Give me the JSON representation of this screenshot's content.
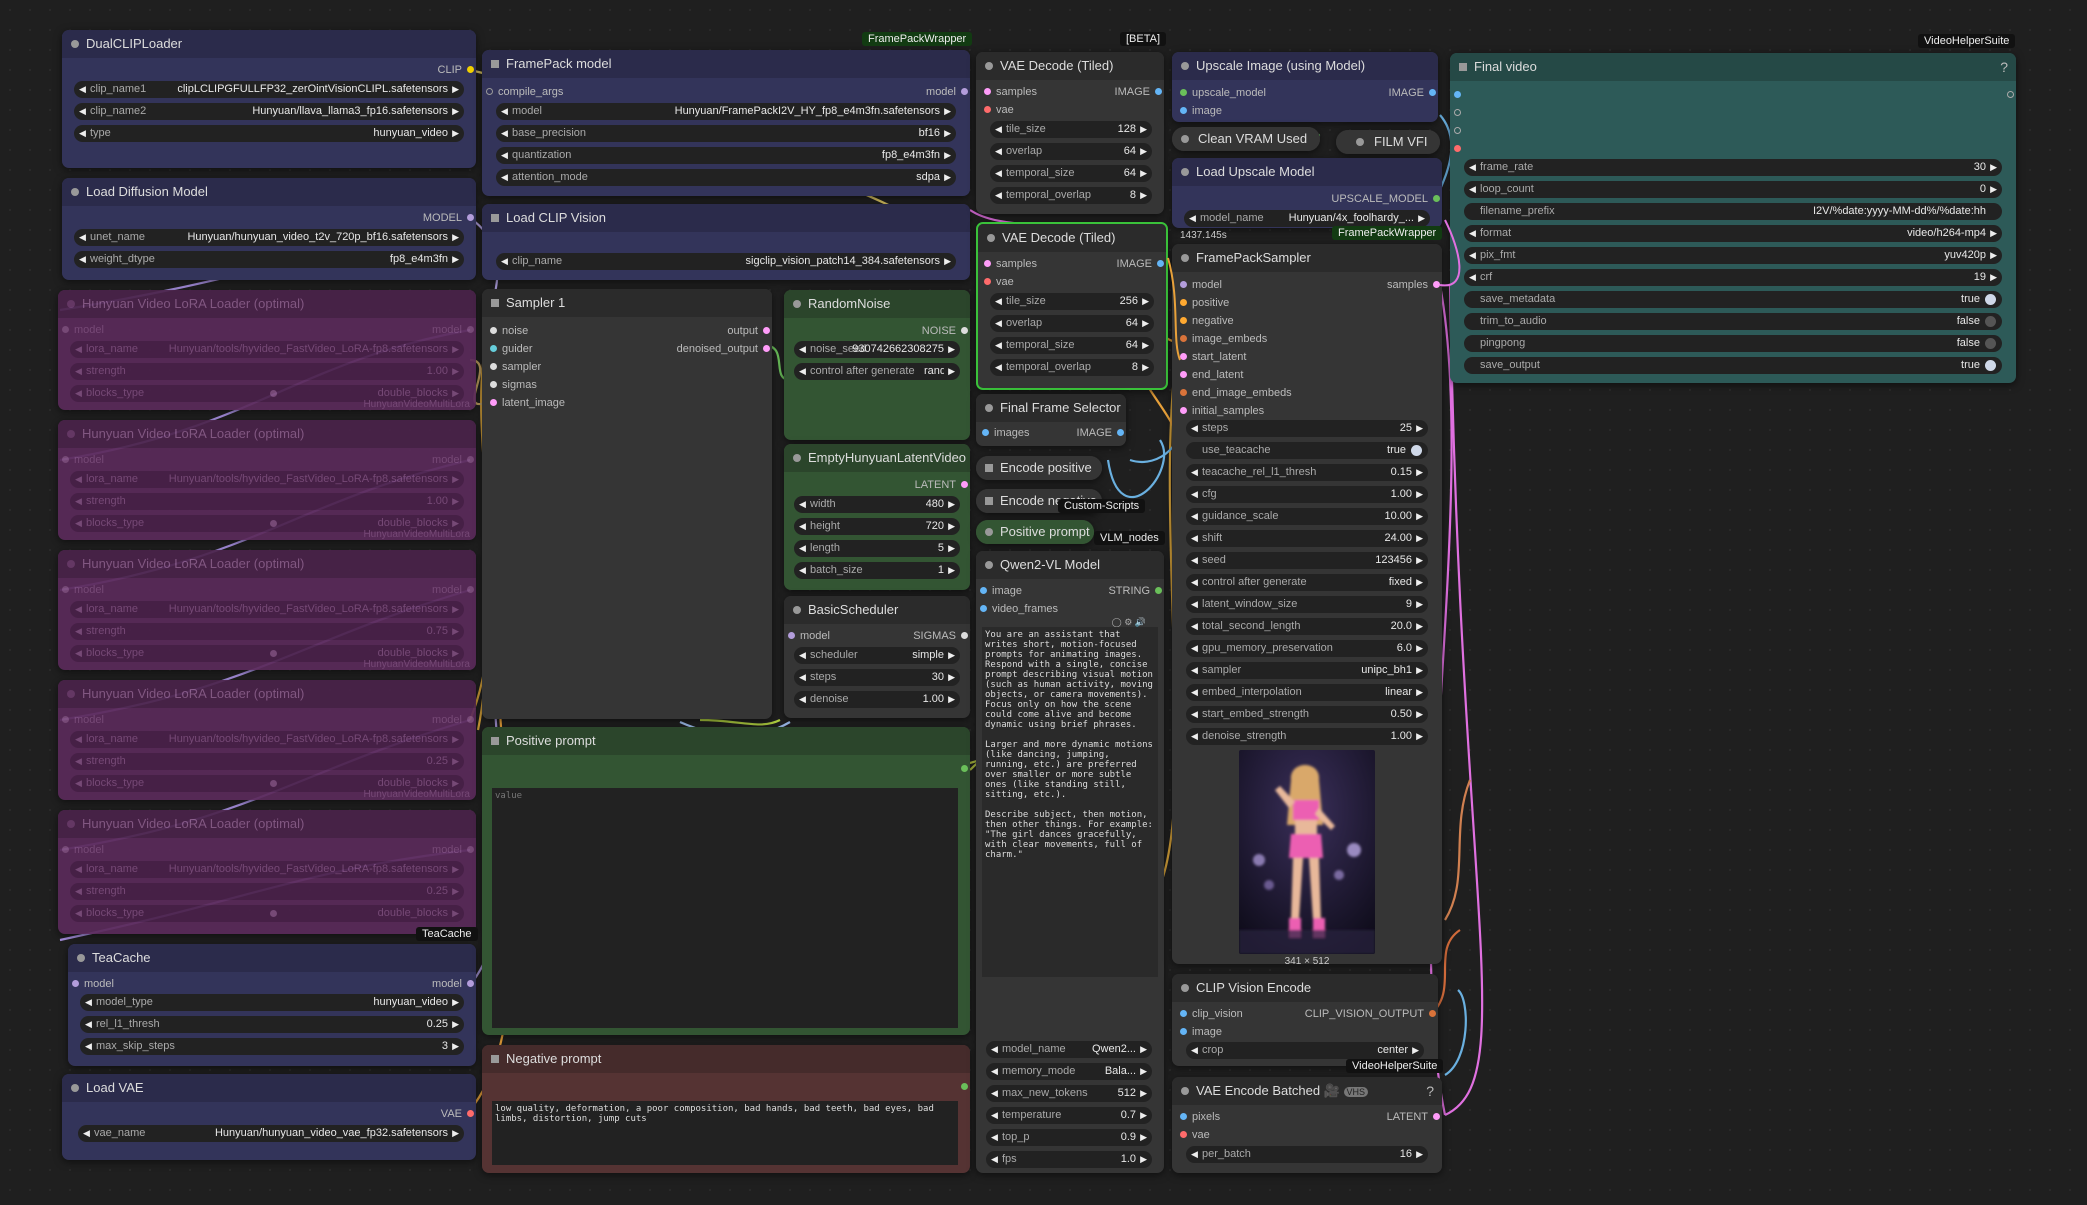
{
  "badges": {
    "framepackwrapper": "FramePackWrapper",
    "beta": "[BETA]",
    "videohelpersuite": "VideoHelperSuite",
    "framepackwrapper2": "FramePackWrapper",
    "customscripts": "Custom-Scripts",
    "vlmnodes": "VLM_nodes",
    "teacache_tag": "TeaCache",
    "videohelpersuite2": "VideoHelperSuite"
  },
  "dualclip": {
    "title": "DualCLIPLoader",
    "out": "CLIP",
    "clip_name1_l": "clip_name1",
    "clip_name1": "clipLCLIPGFULLFP32_zerOintVisionCLIPL.safetensors",
    "clip_name2_l": "clip_name2",
    "clip_name2": "Hunyuan/llava_llama3_fp16.safetensors",
    "type_l": "type",
    "type": "hunyuan_video"
  },
  "loaddiff": {
    "title": "Load Diffusion Model",
    "out": "MODEL",
    "unet_l": "unet_name",
    "unet": "Hunyuan/hunyuan_video_t2v_720p_bf16.safetensors",
    "dtype_l": "weight_dtype",
    "dtype": "fp8_e4m3fn"
  },
  "lora": [
    {
      "title": "Hunyuan Video LoRA Loader (optimal)",
      "lora": "Hunyuan/tools/hyvideo_FastVideo_LoRA-fp8.safetensors",
      "strength": "1.00",
      "blocks": "double_blocks",
      "foot": "HunyuanVideoMultiLora"
    },
    {
      "title": "Hunyuan Video LoRA Loader (optimal)",
      "lora": "Hunyuan/tools/hyvideo_FastVideo_LoRA-fp8.safetensors",
      "strength": "1.00",
      "blocks": "double_blocks",
      "foot": "HunyuanVideoMultiLora"
    },
    {
      "title": "Hunyuan Video LoRA Loader (optimal)",
      "lora": "Hunyuan/tools/hyvideo_FastVideo_LoRA-fp8.safetensors",
      "strength": "0.75",
      "blocks": "double_blocks",
      "foot": "HunyuanVideoMultiLora"
    },
    {
      "title": "Hunyuan Video LoRA Loader (optimal)",
      "lora": "Hunyuan/tools/hyvideo_FastVideo_LoRA-fp8.safetensors",
      "strength": "0.25",
      "blocks": "double_blocks",
      "foot": "HunyuanVideoMultiLora"
    },
    {
      "title": "Hunyuan Video LoRA Loader (optimal)",
      "lora": "Hunyuan/tools/hyvideo_FastVideo_LoRA-fp8.safetensors",
      "strength": "0.25",
      "blocks": "double_blocks",
      "foot": ""
    }
  ],
  "lora_labels": {
    "model": "model",
    "lora_name": "lora_name",
    "strength": "strength",
    "blocks_type": "blocks_type"
  },
  "teacache": {
    "title": "TeaCache",
    "in": "model",
    "out": "model",
    "model_type_l": "model_type",
    "model_type": "hunyuan_video",
    "rel_l": "rel_l1_thresh",
    "rel": "0.25",
    "max_l": "max_skip_steps",
    "max": "3"
  },
  "loadvae": {
    "title": "Load VAE",
    "out": "VAE",
    "vae_l": "vae_name",
    "vae": "Hunyuan/hunyuan_video_vae_fp32.safetensors"
  },
  "framepack": {
    "title": "FramePack model",
    "in": "compile_args",
    "out": "model",
    "model_l": "model",
    "model": "Hunyuan/FramePackI2V_HY_fp8_e4m3fn.safetensors",
    "prec_l": "base_precision",
    "prec": "bf16",
    "quant_l": "quantization",
    "quant": "fp8_e4m3fn",
    "attn_l": "attention_mode",
    "attn": "sdpa"
  },
  "loadclipvision": {
    "title": "Load CLIP Vision",
    "clip_l": "clip_name",
    "clip": "sigclip_vision_patch14_384.safetensors"
  },
  "sampler1": {
    "title": "Sampler 1",
    "in": [
      "noise",
      "guider",
      "sampler",
      "sigmas",
      "latent_image"
    ],
    "out1": "output",
    "out2": "denoised_output"
  },
  "randomnoise": {
    "title": "RandomNoise",
    "out": "NOISE",
    "seed_l": "noise_seed",
    "seed": "930742662308275",
    "ctl_l": "control after generate",
    "ctl": "randomize"
  },
  "emptylatent": {
    "title": "EmptyHunyuanLatentVideo",
    "out": "LATENT",
    "w_l": "width",
    "w": "480",
    "h_l": "height",
    "h": "720",
    "len_l": "length",
    "len": "5",
    "b_l": "batch_size",
    "b": "1"
  },
  "basicsched": {
    "title": "BasicScheduler",
    "in": "model",
    "out": "SIGMAS",
    "sch_l": "scheduler",
    "sch": "simple",
    "steps_l": "steps",
    "steps": "30",
    "den_l": "denoise",
    "den": "1.00"
  },
  "posprompt": {
    "title": "Positive prompt",
    "placeholder": "value"
  },
  "negprompt": {
    "title": "Negative prompt",
    "text": "low quality, deformation, a poor composition, bad hands, bad teeth, bad eyes, bad limbs, distortion, jump cuts"
  },
  "vaedec1": {
    "title": "VAE Decode (Tiled)",
    "in1": "samples",
    "in2": "vae",
    "out": "IMAGE",
    "tile_l": "tile_size",
    "tile": "128",
    "ov_l": "overlap",
    "ov": "64",
    "ts_l": "temporal_size",
    "ts": "64",
    "to_l": "temporal_overlap",
    "to": "8"
  },
  "vaedec2": {
    "title": "VAE Decode (Tiled)",
    "in1": "samples",
    "in2": "vae",
    "out": "IMAGE",
    "tile_l": "tile_size",
    "tile": "256",
    "ov_l": "overlap",
    "ov": "64",
    "ts_l": "temporal_size",
    "ts": "64",
    "to_l": "temporal_overlap",
    "to": "8"
  },
  "finalframe": {
    "title": "Final Frame Selector",
    "in": "images",
    "out": "IMAGE"
  },
  "encpos": {
    "title": "Encode positive"
  },
  "encneg": {
    "title": "Encode negative"
  },
  "pospromptsmall": {
    "title": "Positive prompt"
  },
  "qwen": {
    "title": "Qwen2-VL Model",
    "in1": "image",
    "in2": "video_frames",
    "out": "STRING",
    "text": "You are an assistant that writes short, motion-focused prompts for animating images. Respond with a single, concise prompt describing visual motion (such as human activity, moving objects, or camera movements). Focus only on how the scene could come alive and become dynamic using brief phrases.\n\nLarger and more dynamic motions (like dancing, jumping, running, etc.) are preferred over smaller or more subtle ones (like standing still, sitting, etc.).\n\nDescribe subject, then motion, then other things. For example: \"The girl dances gracefully, with clear movements, full of charm.\"",
    "mn_l": "model_name",
    "mn": "Qwen2...",
    "mm_l": "memory_mode",
    "mm": "Bala...",
    "mt_l": "max_new_tokens",
    "mt": "512",
    "t_l": "temperature",
    "t": "0.7",
    "tp_l": "top_p",
    "tp": "0.9",
    "fps_l": "fps",
    "fps": "1.0"
  },
  "upscale": {
    "title": "Upscale Image (using Model)",
    "in1": "upscale_model",
    "in2": "image",
    "out": "IMAGE"
  },
  "cleanvram": {
    "title": "Clean VRAM Used"
  },
  "filmvfi": {
    "title": "FILM VFI"
  },
  "loadupscale": {
    "title": "Load Upscale Model",
    "out": "UPSCALE_MODEL",
    "mn_l": "model_name",
    "mn": "Hunyuan/4x_foolhardy_...",
    "time": "1437.145s"
  },
  "fpsampler": {
    "title": "FramePackSampler",
    "in": [
      "model",
      "positive",
      "negative",
      "image_embeds",
      "start_latent",
      "end_latent",
      "end_image_embeds",
      "initial_samples"
    ],
    "out": "samples",
    "w": [
      [
        "steps",
        "25"
      ],
      [
        "use_teacache",
        "true"
      ],
      [
        "teacache_rel_l1_thresh",
        "0.15"
      ],
      [
        "cfg",
        "1.00"
      ],
      [
        "guidance_scale",
        "10.00"
      ],
      [
        "shift",
        "24.00"
      ],
      [
        "seed",
        "123456"
      ],
      [
        "control after generate",
        "fixed"
      ],
      [
        "latent_window_size",
        "9"
      ],
      [
        "total_second_length",
        "20.0"
      ],
      [
        "gpu_memory_preservation",
        "6.0"
      ],
      [
        "sampler",
        "unipc_bh1"
      ],
      [
        "embed_interpolation",
        "linear"
      ],
      [
        "start_embed_strength",
        "0.50"
      ],
      [
        "denoise_strength",
        "1.00"
      ]
    ],
    "imgsize": "341 × 512"
  },
  "clipvisionenc": {
    "title": "CLIP Vision Encode",
    "in1": "clip_vision",
    "in2": "image",
    "out": "CLIP_VISION_OUTPUT",
    "crop_l": "crop",
    "crop": "center"
  },
  "vaeencb": {
    "title": "VAE Encode Batched 🎥",
    "badge": "VHS",
    "q": "?",
    "in1": "pixels",
    "in2": "vae",
    "out": "LATENT",
    "pb_l": "per_batch",
    "pb": "16"
  },
  "finalvideo": {
    "title": "Final video",
    "q": "?",
    "w": [
      [
        "frame_rate",
        "30"
      ],
      [
        "loop_count",
        "0"
      ],
      [
        "filename_prefix",
        "I2V/%date:yyyy-MM-dd%/%date:hh"
      ],
      [
        "format",
        "video/h264-mp4"
      ],
      [
        "pix_fmt",
        "yuv420p"
      ],
      [
        "crf",
        "19"
      ],
      [
        "save_metadata",
        "true"
      ],
      [
        "trim_to_audio",
        "false"
      ],
      [
        "pingpong",
        "false"
      ],
      [
        "save_output",
        "true"
      ]
    ]
  }
}
